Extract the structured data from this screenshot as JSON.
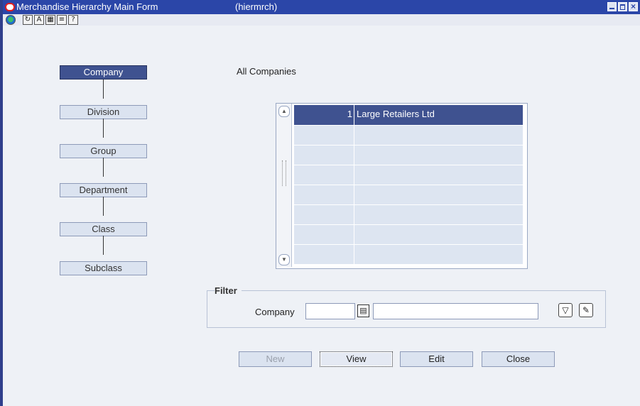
{
  "window": {
    "title": "Merchandise Hierarchy Main Form",
    "form_code": "(hiermrch)",
    "controls": {
      "close_glyph": "×"
    }
  },
  "toolbar": {
    "icons": [
      "globe-icon",
      "refresh-icon",
      "find-replace-icon",
      "calendar-icon",
      "notes-icon",
      "help-icon"
    ],
    "glyphs": {
      "globe": "●",
      "refresh": "↻",
      "find": "A",
      "calendar": "▦",
      "notes": "≡",
      "help": "?"
    }
  },
  "hierarchy": {
    "company": "Company",
    "division": "Division",
    "group": "Group",
    "department": "Department",
    "class": "Class",
    "subclass": "Subclass"
  },
  "main": {
    "all_companies_label": "All Companies",
    "scroll_up_glyph": "▲",
    "scroll_down_glyph": "▼",
    "rows": [
      {
        "num": "1",
        "name": "Large Retailers Ltd"
      }
    ]
  },
  "filter": {
    "legend": "Filter",
    "company_label": "Company",
    "company_code_value": "",
    "company_name_value": "",
    "lov_glyph": "▤",
    "apply_glyph": "▽",
    "clear_glyph": "✎"
  },
  "actions": {
    "new": "New",
    "view": "View",
    "edit": "Edit",
    "close": "Close"
  },
  "colors": {
    "titlebar": "#2b46a8",
    "selected": "#3f5290",
    "button": "#dbe3f0",
    "background": "#eef1f6"
  }
}
